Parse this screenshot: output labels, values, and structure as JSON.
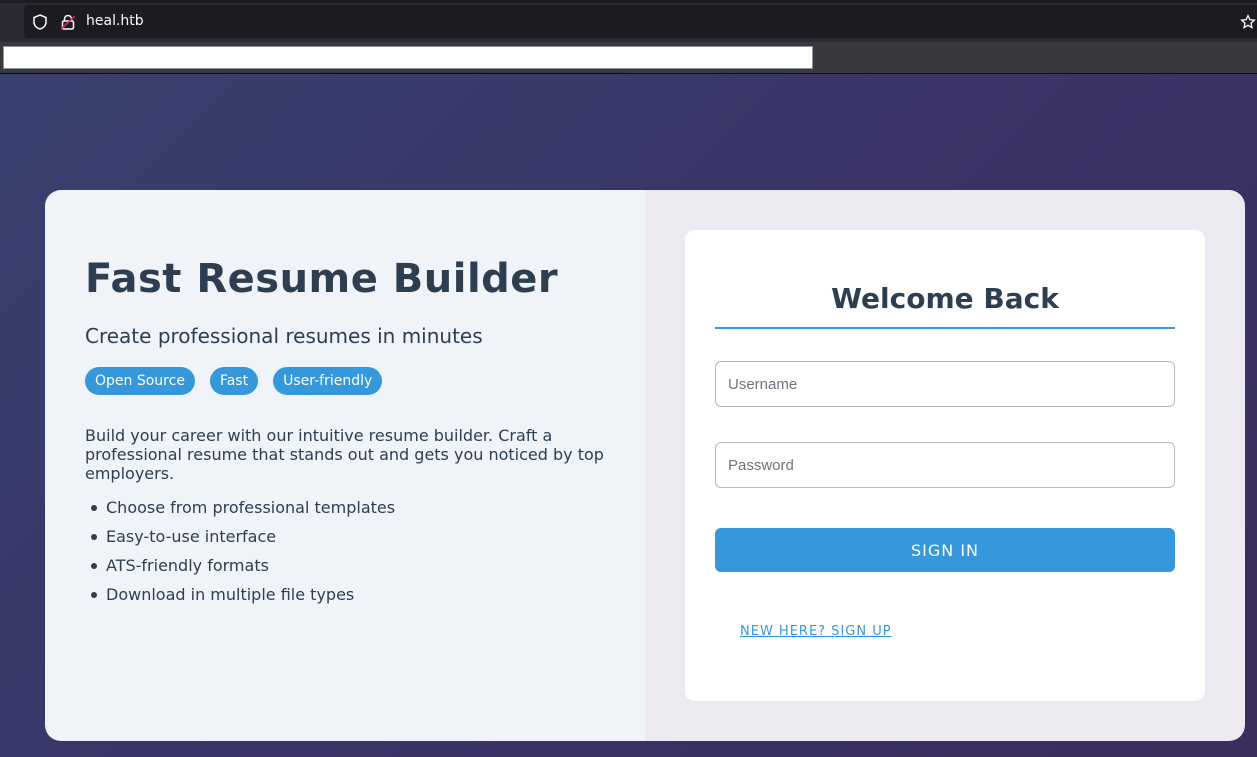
{
  "browser": {
    "url": "heal.htb",
    "icons": [
      "shield-icon",
      "lock-icon",
      "star-icon"
    ]
  },
  "left": {
    "title": "Fast Resume Builder",
    "subtitle": "Create professional resumes in minutes",
    "tags": [
      "Open Source",
      "Fast",
      "User-friendly"
    ],
    "description": "Build your career with our intuitive resume builder. Craft a professional resume that stands out and gets you noticed by top employers.",
    "features": [
      "Choose from professional templates",
      "Easy-to-use interface",
      "ATS-friendly formats",
      "Download in multiple file types"
    ]
  },
  "login": {
    "heading": "Welcome Back",
    "username_placeholder": "Username",
    "password_placeholder": "Password",
    "signin_label": "SIGN IN",
    "signup_label": "NEW HERE? SIGN UP"
  },
  "colors": {
    "accent": "#3498db",
    "text": "#2c3e50"
  }
}
